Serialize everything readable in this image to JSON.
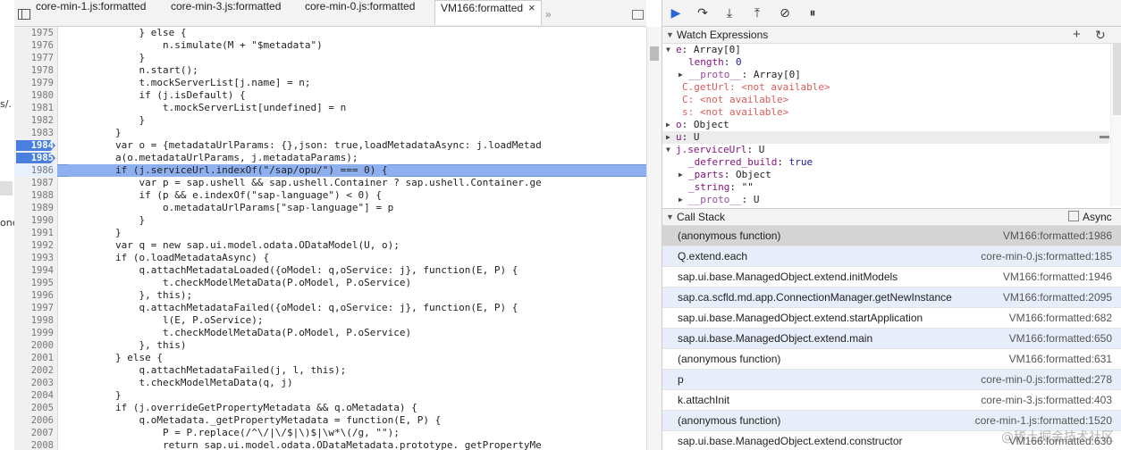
{
  "colors": {
    "breakpoint": "#4a7fe0",
    "current_line": "#8fb0ef",
    "resume_icon": "#2a65d8"
  },
  "left_strip": {
    "frag1": "s/.",
    "frag2": "one"
  },
  "tabs": [
    {
      "label": "core-min-1.js:formatted"
    },
    {
      "label": "core-min-3.js:formatted"
    },
    {
      "label": "core-min-0.js:formatted"
    },
    {
      "label": "VM166:formatted",
      "close": "×"
    }
  ],
  "tabs_more": "»",
  "debugger_toolbar": [
    "resume-icon",
    "step-over-icon",
    "step-into-icon",
    "step-out-icon",
    "deactivate-breakpoints-icon",
    "pause-on-exceptions-icon"
  ],
  "code_lines": [
    {
      "n": "1975",
      "code": "            } else {"
    },
    {
      "n": "1976",
      "code": "                n.simulate(M + \"$metadata\")"
    },
    {
      "n": "1977",
      "code": "            }"
    },
    {
      "n": "1978",
      "code": "            n.start();"
    },
    {
      "n": "1979",
      "code": "            t.mockServerList[j.name] = n;"
    },
    {
      "n": "1980",
      "code": "            if (j.isDefault) {"
    },
    {
      "n": "1981",
      "code": "                t.mockServerList[undefined] = n"
    },
    {
      "n": "1982",
      "code": "            }"
    },
    {
      "n": "1983",
      "code": "        }"
    },
    {
      "n": "1984",
      "code": "        var o = {metadataUrlParams: {},json: true,loadMetadataAsync: j.loadMetad",
      "bp": true
    },
    {
      "n": "1985",
      "code": "        a(o.metadataUrlParams, j.metadataParams);",
      "bp": true
    },
    {
      "n": "1986",
      "code": "        if (j.serviceUrl.indexOf(\"/sap/opu/\") === 0) {",
      "current": true
    },
    {
      "n": "1987",
      "code": "            var p = sap.ushell && sap.ushell.Container ? sap.ushell.Container.ge"
    },
    {
      "n": "1988",
      "code": "            if (p && e.indexOf(\"sap-language\") < 0) {"
    },
    {
      "n": "1989",
      "code": "                o.metadataUrlParams[\"sap-language\"] = p"
    },
    {
      "n": "1990",
      "code": "            }"
    },
    {
      "n": "1991",
      "code": "        }"
    },
    {
      "n": "1992",
      "code": "        var q = new sap.ui.model.odata.ODataModel(U, o);"
    },
    {
      "n": "1993",
      "code": "        if (o.loadMetadataAsync) {"
    },
    {
      "n": "1994",
      "code": "            q.attachMetadataLoaded({oModel: q,oService: j}, function(E, P) {"
    },
    {
      "n": "1995",
      "code": "                t.checkModelMetaData(P.oModel, P.oService)"
    },
    {
      "n": "1996",
      "code": "            }, this);"
    },
    {
      "n": "1997",
      "code": "            q.attachMetadataFailed({oModel: q,oService: j}, function(E, P) {"
    },
    {
      "n": "1998",
      "code": "                l(E, P.oService);"
    },
    {
      "n": "1999",
      "code": "                t.checkModelMetaData(P.oModel, P.oService)"
    },
    {
      "n": "2000",
      "code": "            }, this)"
    },
    {
      "n": "2001",
      "code": "        } else {"
    },
    {
      "n": "2002",
      "code": "            q.attachMetadataFailed(j, l, this);"
    },
    {
      "n": "2003",
      "code": "            t.checkModelMetaData(q, j)"
    },
    {
      "n": "2004",
      "code": "        }"
    },
    {
      "n": "2005",
      "code": "        if (j.overrideGetPropertyMetadata && q.oMetadata) {"
    },
    {
      "n": "2006",
      "code": "            q.oMetadata._getPropertyMetadata = function(E, P) {"
    },
    {
      "n": "2007",
      "code": "                P = P.replace(/^\\/|\\/$|\\)$|\\w*\\(/g, \"\");"
    },
    {
      "n": "2008",
      "code": "                return sap.ui.model.odata.ODataMetadata.prototype._getPropertyMe"
    }
  ],
  "watch": {
    "title": "Watch Expressions",
    "add": "+",
    "refresh": "↻",
    "lines": [
      {
        "tri": "▼",
        "key": "e",
        "sep": ": ",
        "val": "Array[0]",
        "indent": 0
      },
      {
        "key": "length",
        "sep": ": ",
        "val": "0",
        "indent": 2,
        "valcls": "val"
      },
      {
        "tri": "▶",
        "key": "__proto__",
        "sep": ": ",
        "val": "Array[0]",
        "indent": 2,
        "keycls": "dim"
      },
      {
        "key": "C.getUrl",
        "sep": ": ",
        "val": "<not available>",
        "indent": 1,
        "na": true
      },
      {
        "key": "C",
        "sep": ": ",
        "val": "<not available>",
        "indent": 1,
        "na": true
      },
      {
        "key": "s",
        "sep": ": ",
        "val": "<not available>",
        "indent": 1,
        "na": true
      },
      {
        "tri": "▶",
        "key": "o",
        "sep": ": ",
        "val": "Object",
        "indent": 0
      },
      {
        "tri": "▶",
        "key": "u",
        "sep": ": ",
        "val": "U",
        "indent": 0,
        "shade": true
      },
      {
        "tri": "▼",
        "key": "j.serviceUrl",
        "sep": ": ",
        "val": "U",
        "indent": 0
      },
      {
        "key": "_deferred_build",
        "sep": ": ",
        "val": "true",
        "indent": 2,
        "valcls": "val"
      },
      {
        "tri": "▶",
        "key": "_parts",
        "sep": ": ",
        "val": "Object",
        "indent": 2
      },
      {
        "key": "_string",
        "sep": ": ",
        "val": "\"\"",
        "indent": 2
      },
      {
        "tri": "▶",
        "key": "__proto__",
        "sep": ": ",
        "val": "U",
        "indent": 2,
        "keycls": "dim"
      }
    ]
  },
  "call_stack": {
    "title": "Call Stack",
    "async_label": "Async",
    "frames": [
      {
        "fn": "(anonymous function)",
        "loc": "VM166:formatted:1986"
      },
      {
        "fn": "Q.extend.each",
        "loc": "core-min-0.js:formatted:185"
      },
      {
        "fn": "sap.ui.base.ManagedObject.extend.initModels",
        "loc": "VM166:formatted:1946"
      },
      {
        "fn": "sap.ca.scfld.md.app.ConnectionManager.getNewInstance",
        "loc": "VM166:formatted:2095"
      },
      {
        "fn": "sap.ui.base.ManagedObject.extend.startApplication",
        "loc": "VM166:formatted:682"
      },
      {
        "fn": "sap.ui.base.ManagedObject.extend.main",
        "loc": "VM166:formatted:650"
      },
      {
        "fn": "(anonymous function)",
        "loc": "VM166:formatted:631"
      },
      {
        "fn": "p",
        "loc": "core-min-0.js:formatted:278"
      },
      {
        "fn": "k.attachInit",
        "loc": "core-min-3.js:formatted:403"
      },
      {
        "fn": "(anonymous function)",
        "loc": "core-min-1.js:formatted:1520"
      },
      {
        "fn": "sap.ui.base.ManagedObject.extend.constructor",
        "loc": "VM166:formatted:630"
      }
    ]
  },
  "watermark": "@稀土掘金技术社区"
}
